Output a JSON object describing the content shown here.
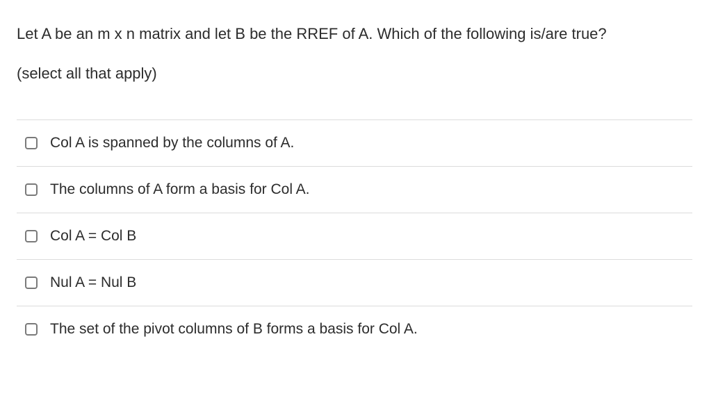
{
  "question": {
    "stem": "Let A be an m x n matrix and let B be the RREF of A.  Which of the following is/are true?",
    "instruction": "(select all that apply)"
  },
  "options": [
    {
      "label": "Col A is spanned by the columns of A."
    },
    {
      "label": "The columns of A form a basis for Col A."
    },
    {
      "label": "Col A = Col B"
    },
    {
      "label": "Nul A = Nul B"
    },
    {
      "label": "The set of the pivot columns of B forms a basis for Col A."
    }
  ]
}
